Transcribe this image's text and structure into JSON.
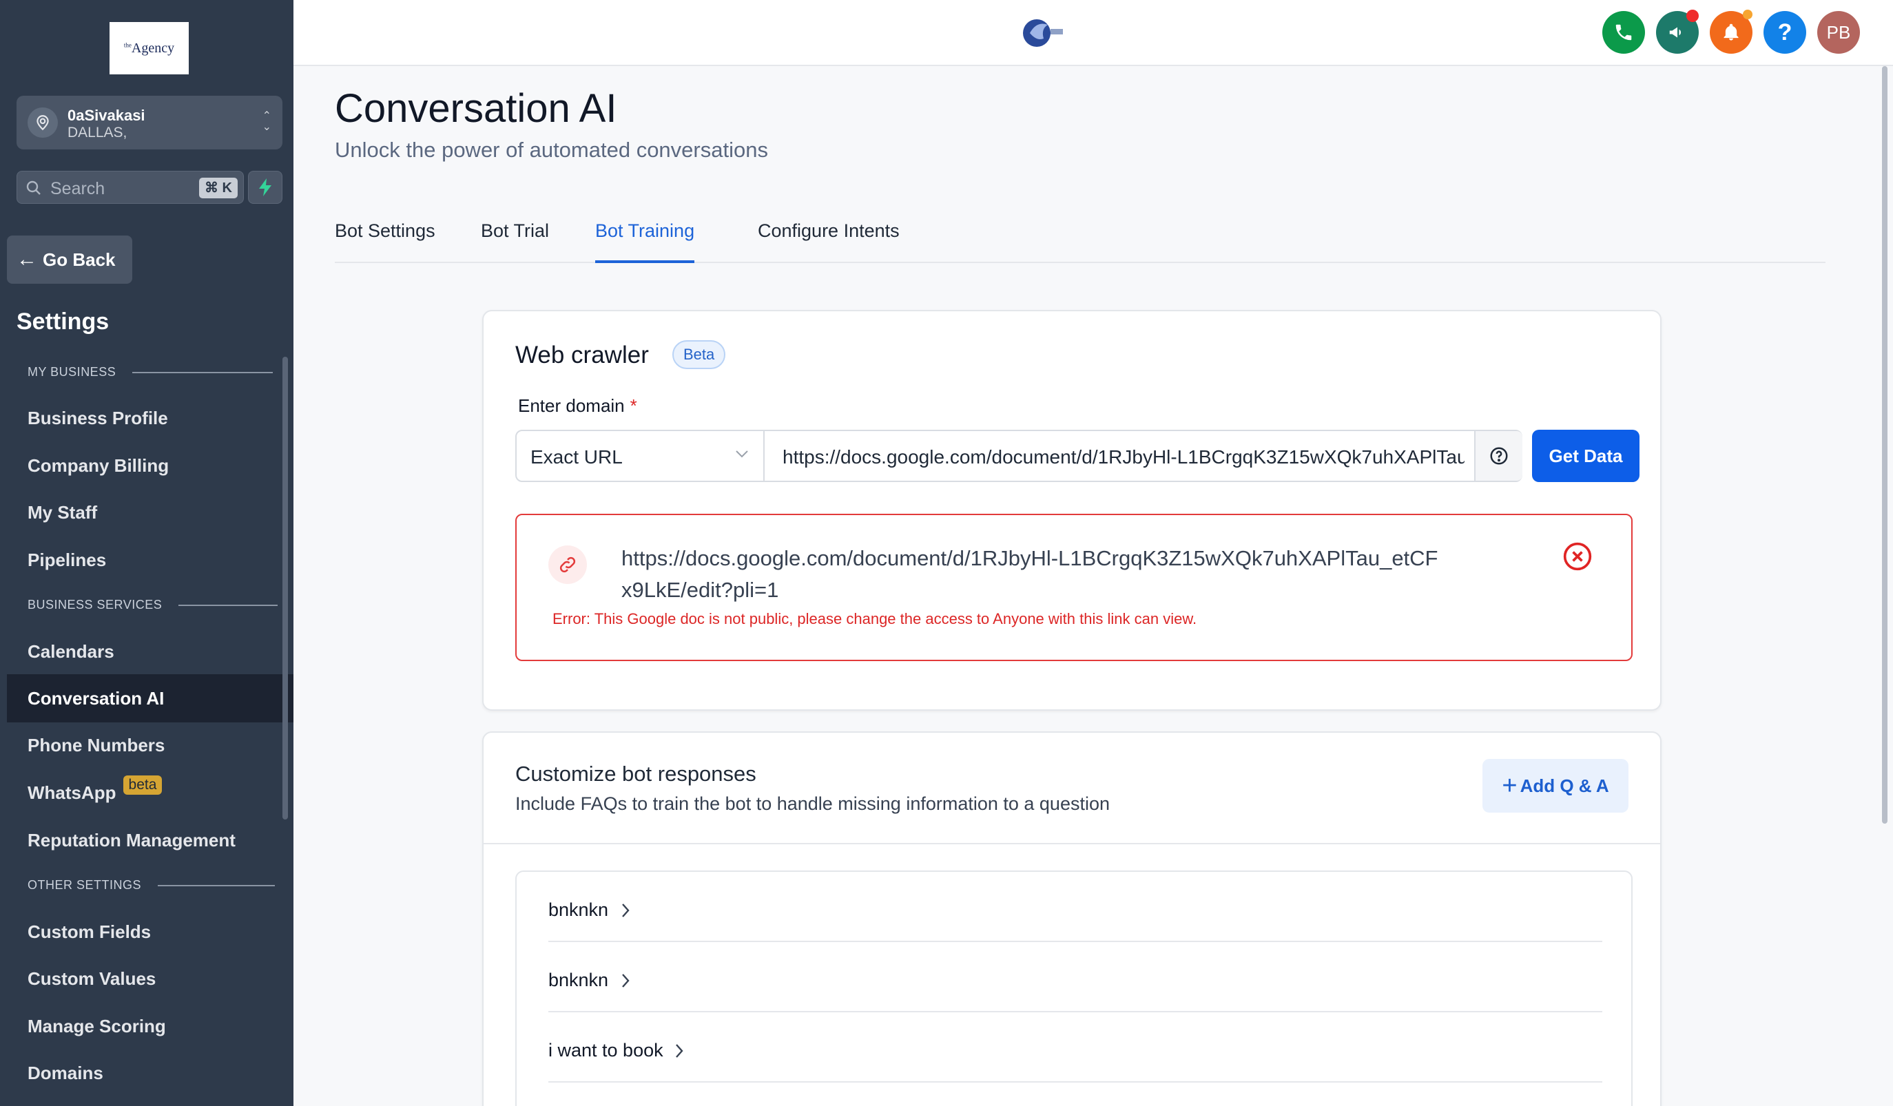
{
  "sidebar": {
    "logo_text": "Agency",
    "logo_super": "the",
    "location": {
      "name": "0aSivakasi",
      "city": "DALLAS,"
    },
    "search": {
      "placeholder": "Search",
      "shortcut": "⌘ K"
    },
    "go_back": "Go Back",
    "settings_title": "Settings",
    "sections": {
      "my_business": "MY BUSINESS",
      "business_services": "BUSINESS SERVICES",
      "other_settings": "OTHER SETTINGS"
    },
    "items": {
      "business_profile": "Business Profile",
      "company_billing": "Company Billing",
      "my_staff": "My Staff",
      "pipelines": "Pipelines",
      "calendars": "Calendars",
      "conversation_ai": "Conversation AI",
      "phone_numbers": "Phone Numbers",
      "whatsapp": "WhatsApp",
      "whatsapp_badge": "beta",
      "reputation_management": "Reputation Management",
      "custom_fields": "Custom Fields",
      "custom_values": "Custom Values",
      "manage_scoring": "Manage Scoring",
      "domains": "Domains"
    },
    "active_item": "Conversation AI"
  },
  "topbar": {
    "icons": [
      "phone-icon",
      "megaphone-icon",
      "bell-icon",
      "help-icon",
      "avatar"
    ],
    "avatar_initials": "PB",
    "help_glyph": "?",
    "colors": {
      "phone": "#0b9a4a",
      "megaphone": "#1d7a6a",
      "bell": "#f26a1b",
      "help": "#1282e8",
      "avatar": "#b4655e"
    }
  },
  "page": {
    "title": "Conversation AI",
    "subtitle": "Unlock the power of automated conversations"
  },
  "tabs": [
    {
      "label": "Bot Settings",
      "active": false
    },
    {
      "label": "Bot Trial",
      "active": false
    },
    {
      "label": "Bot Training",
      "active": true
    },
    {
      "label": "Configure Intents",
      "active": false
    }
  ],
  "web_crawler": {
    "title": "Web crawler",
    "badge": "Beta",
    "domain_label": "Enter domain",
    "required_mark": "*",
    "match_type": "Exact URL",
    "url_value": "https://docs.google.com/document/d/1RJbyHl-L1BCrgqK3Z15wXQk7uhXAPlTau_etCFx9LkE/edit?pli=1",
    "get_data_label": "Get Data",
    "error": {
      "url": "https://docs.google.com/document/d/1RJbyHl-L1BCrgqK3Z15wXQk7uhXAPlTau_etCFx9LkE/edit?pli=1",
      "message": "Error: This Google doc is not public, please change the access to Anyone with this link can view."
    }
  },
  "bot_responses": {
    "title": "Customize bot responses",
    "description": "Include FAQs to train the bot to handle missing information to a question",
    "add_label": "Add Q & A",
    "add_plus": "+",
    "items": [
      "bnknkn",
      "bnknkn",
      "i want to book"
    ]
  },
  "colors": {
    "sidebar_bg": "#2e3a4b",
    "accent": "#1d63d8",
    "primary_button": "#0d5ee8",
    "error": "#dc2626"
  }
}
